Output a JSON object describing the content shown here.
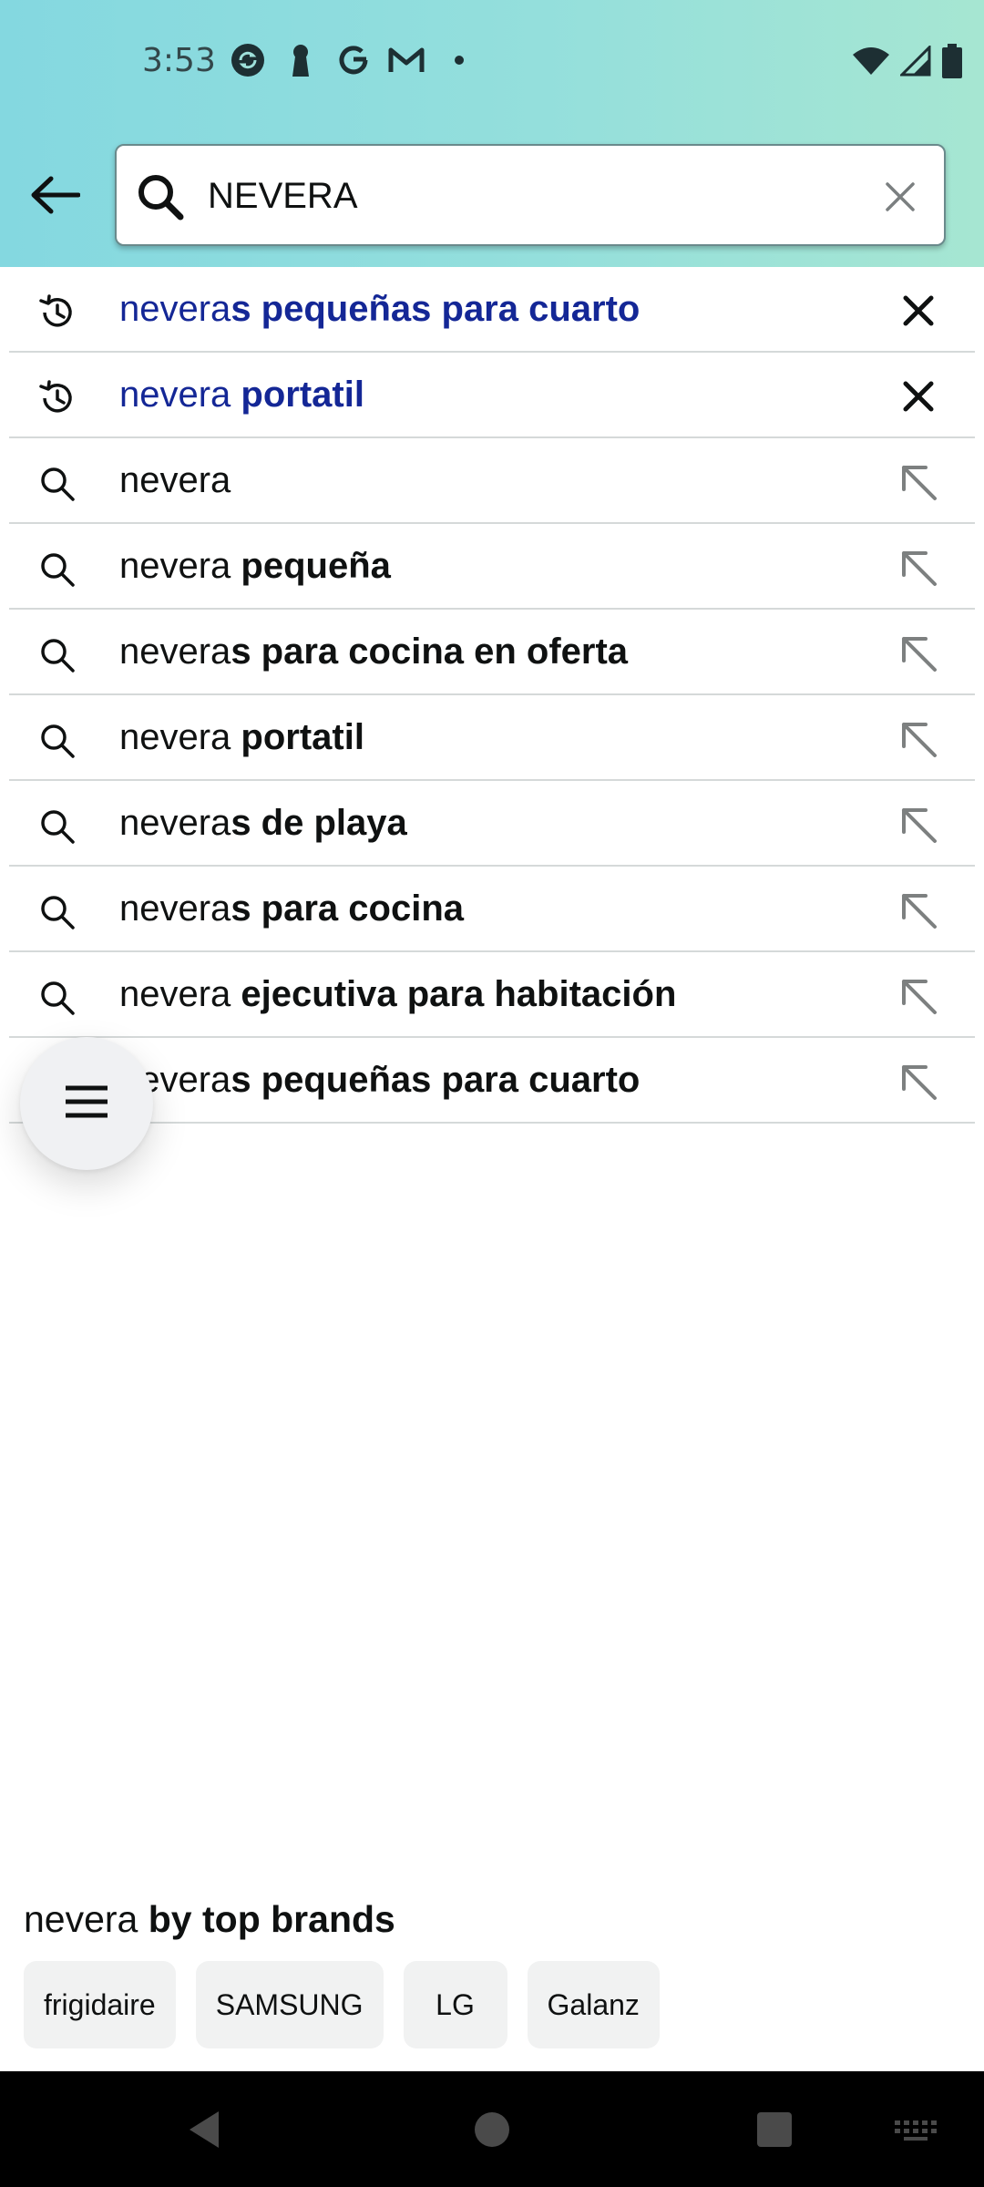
{
  "status_bar": {
    "time": "3:53",
    "left_icons": [
      "sync-app-icon",
      "keyhole-app-icon",
      "google-icon",
      "gmail-icon",
      "notification-dot-icon"
    ],
    "right_icons": [
      "wifi-icon",
      "cell-signal-icon",
      "battery-icon"
    ]
  },
  "search": {
    "query": "NEVERA",
    "back_icon": "arrow-left-icon",
    "search_icon": "search-icon",
    "clear_icon": "close-icon"
  },
  "suggestions": [
    {
      "type": "history",
      "prefix": "nevera",
      "rest": "s pequeñas para cuarto",
      "rest_bold": true
    },
    {
      "type": "history",
      "prefix": "nevera ",
      "rest": "portatil",
      "rest_bold": true
    },
    {
      "type": "search",
      "prefix": "nevera",
      "rest": "",
      "rest_bold": false
    },
    {
      "type": "search",
      "prefix": "nevera ",
      "rest": "pequeña",
      "rest_bold": true
    },
    {
      "type": "search",
      "prefix": "nevera",
      "rest": "s para cocina en oferta",
      "rest_bold": true
    },
    {
      "type": "search",
      "prefix": "nevera ",
      "rest": "portatil",
      "rest_bold": true
    },
    {
      "type": "search",
      "prefix": "nevera",
      "rest": "s de playa",
      "rest_bold": true
    },
    {
      "type": "search",
      "prefix": "nevera",
      "rest": "s para cocina",
      "rest_bold": true
    },
    {
      "type": "search",
      "prefix": "nevera ",
      "rest": "ejecutiva para habitación",
      "rest_bold": true
    },
    {
      "type": "search",
      "prefix": "nevera",
      "rest": "s pequeñas para cuarto",
      "rest_bold": true
    }
  ],
  "fab": {
    "icon": "menu-icon"
  },
  "brands": {
    "title_prefix": "nevera ",
    "title_bold": "by top brands",
    "chips": [
      "frigidaire",
      "SAMSUNG",
      "LG",
      "Galanz"
    ]
  },
  "nav": {
    "icons": [
      "nav-back-icon",
      "nav-home-icon",
      "nav-recents-icon",
      "keyboard-icon"
    ]
  },
  "colors": {
    "history_text": "#142796",
    "header_gradient_start": "#84d8e0",
    "header_gradient_end": "#a6e6d2"
  }
}
